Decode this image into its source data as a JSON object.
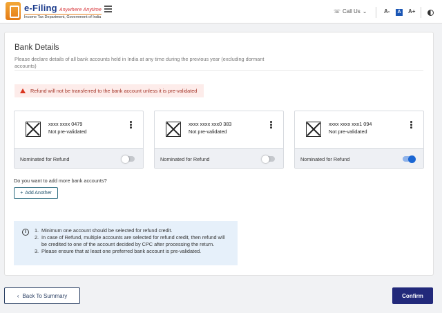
{
  "header": {
    "logo_title": "e-Filing",
    "logo_tagline": "Anywhere Anytime",
    "logo_subtitle": "Income Tax Department, Government of India",
    "call_us": "Call Us",
    "font_decrease": "A-",
    "font_default": "A",
    "font_increase": "A+"
  },
  "main": {
    "title": "Bank Details",
    "description": "Please declare details of all bank accounts held in India at any time during the previous year (excluding dormant accounts)",
    "warning": "Refund will not be transferred to the bank account unless it is pre-validated",
    "accounts": [
      {
        "number": "xxxx xxxx 0479",
        "status": "Not pre-validated",
        "nominated_label": "Nominated for Refund",
        "nominated": false
      },
      {
        "number": "xxxx xxxx xxx0 383",
        "status": "Not pre-validated",
        "nominated_label": "Nominated for Refund",
        "nominated": false
      },
      {
        "number": "xxxx xxxx xxx1 094",
        "status": "Not pre-validated",
        "nominated_label": "Nominated for Refund",
        "nominated": true
      }
    ],
    "add_question": "Do you want to add more bank accounts?",
    "add_button": "Add Another",
    "info": [
      {
        "num": "1.",
        "text": "Minimum one account should be selected for refund credit."
      },
      {
        "num": "2.",
        "text": "In case of Refund, multiple accounts are selected for refund credit, then refund will be credited to one of the account decided by CPC after processing the return."
      },
      {
        "num": "3.",
        "text": "Please ensure that at least one preferred bank account is pre-validated."
      }
    ]
  },
  "footer": {
    "back_label": "Back To Summary",
    "confirm_label": "Confirm"
  },
  "colors": {
    "primary": "#22297a",
    "toggle_on": "#1a66d3",
    "warning_bg": "#fdecea",
    "info_bg": "#e6f0fa"
  }
}
